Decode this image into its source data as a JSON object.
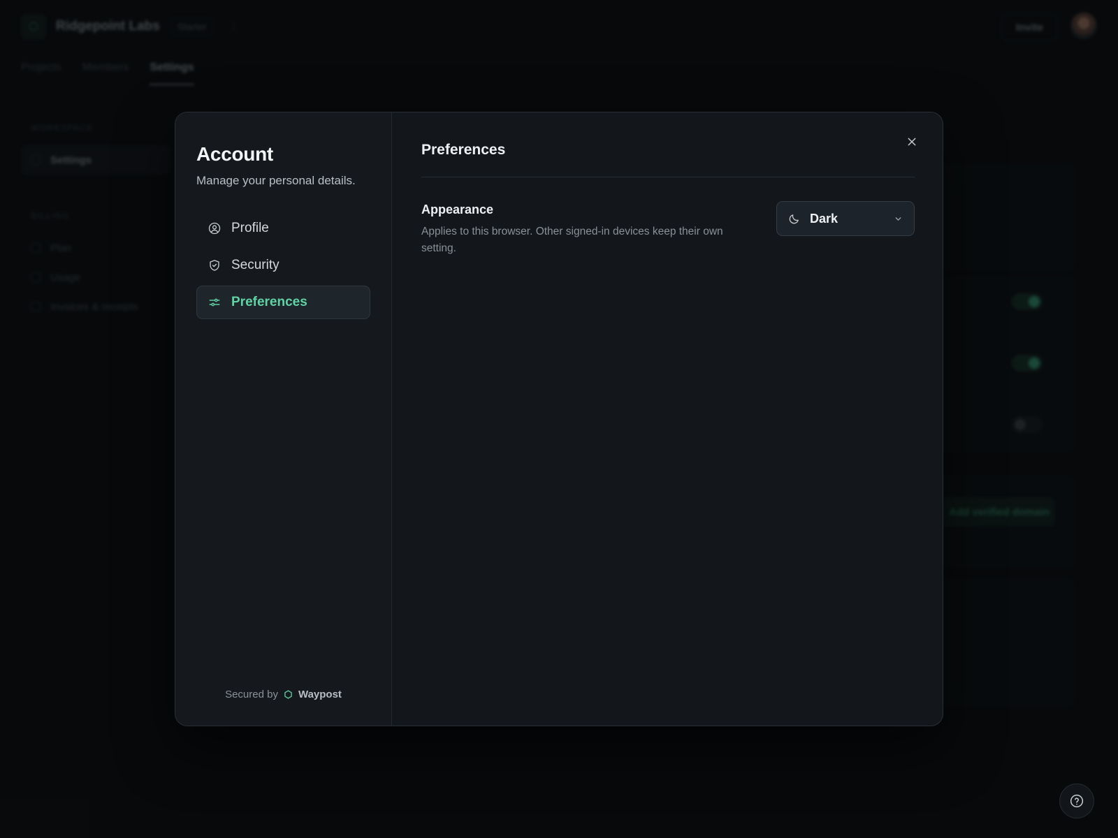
{
  "background": {
    "org_name": "Ridgepoint Labs",
    "plan_badge": "Starter",
    "invite_label": "Invite",
    "tabs": [
      {
        "label": "Projects"
      },
      {
        "label": "Members"
      },
      {
        "label": "Settings",
        "active": true
      }
    ],
    "sidebar": {
      "workspace_heading": "WORKSPACE",
      "workspace_items": [
        {
          "label": "Settings",
          "active": true
        }
      ],
      "billing_heading": "BILLING",
      "billing_items": [
        {
          "label": "Plan"
        },
        {
          "label": "Usage"
        },
        {
          "label": "Invoices & receipts"
        }
      ]
    },
    "verified_domain_label": "Add verified domain"
  },
  "modal": {
    "title": "Account",
    "subtitle": "Manage your personal details.",
    "nav": [
      {
        "label": "Profile",
        "icon": "user-circle-icon"
      },
      {
        "label": "Security",
        "icon": "shield-check-icon"
      },
      {
        "label": "Preferences",
        "icon": "sliders-icon",
        "active": true
      }
    ],
    "footer": {
      "secured_by": "Secured by",
      "brand": "Waypost"
    },
    "main": {
      "title": "Preferences",
      "appearance": {
        "label": "Appearance",
        "description": "Applies to this browser. Other signed-in devices keep their own setting.",
        "selected": "Dark",
        "icon": "moon-icon"
      }
    }
  },
  "colors": {
    "accent": "#5fd3a4",
    "modal_bg": "#13171c",
    "page_bg": "#0a0c0f"
  }
}
